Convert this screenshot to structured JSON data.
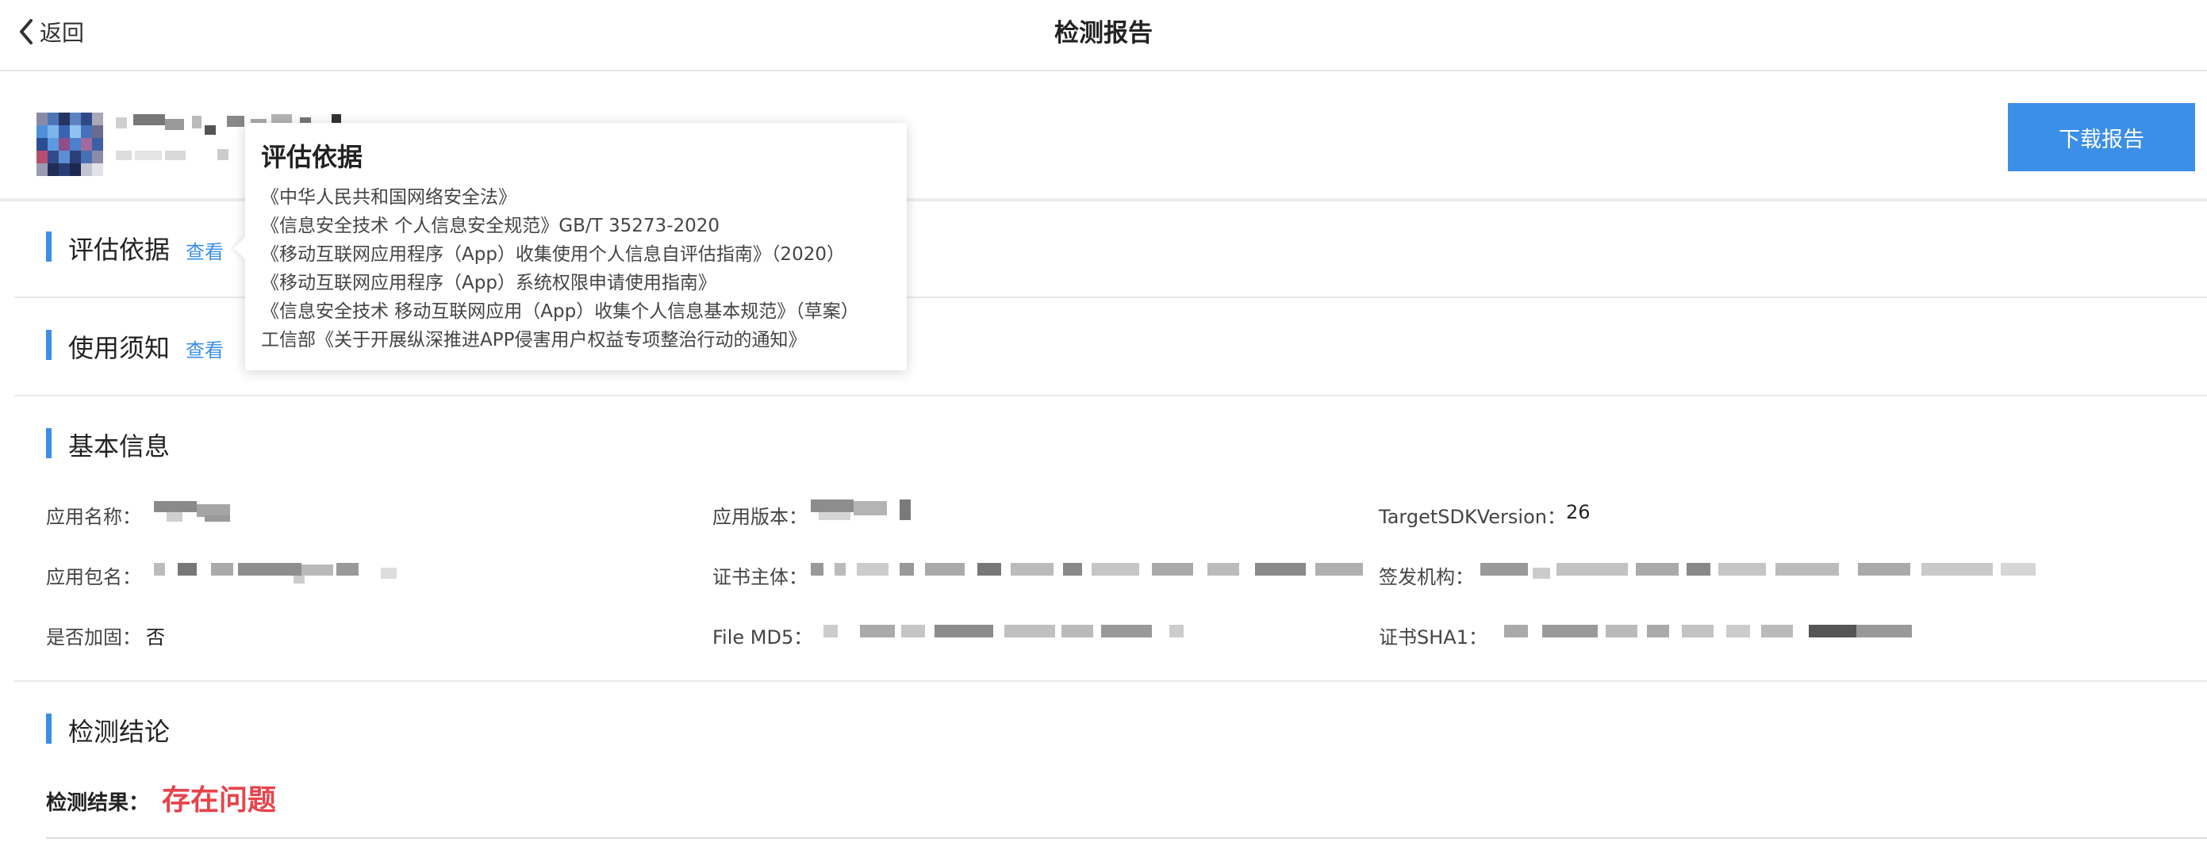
{
  "nav": {
    "back_label": "返回",
    "title": "检测报告"
  },
  "header": {
    "download_label": "下载报告"
  },
  "sections": {
    "basis": {
      "title": "评估依据",
      "link": "查看"
    },
    "notice": {
      "title": "使用须知",
      "link": "查看"
    },
    "basic": {
      "title": "基本信息"
    },
    "conclusion": {
      "title": "检测结论"
    }
  },
  "basic_info": {
    "app_name_label": "应用名称：",
    "app_version_label": "应用版本：",
    "target_sdk_label": "TargetSDKVersion：",
    "target_sdk_value": "26",
    "package_label": "应用包名：",
    "cert_subject_label": "证书主体：",
    "issuer_label": "签发机构：",
    "hardened_label": "是否加固：",
    "hardened_value": "否",
    "md5_label": "File MD5：",
    "sha1_label": "证书SHA1："
  },
  "result": {
    "label": "检测结果：",
    "value": "存在问题"
  },
  "tooltip": {
    "title": "评估依据",
    "items": [
      "《中华人民共和国网络安全法》",
      "《信息安全技术 个人信息安全规范》GB/T 35273-2020",
      "《移动互联网应用程序（App）收集使用个人信息自评估指南》（2020）",
      "《移动互联网应用程序（App）系统权限申请使用指南》",
      "《信息安全技术 移动互联网应用（App）收集个人信息基本规范》（草案）",
      "工信部《关于开展纵深推进APP侵害用户权益专项整治行动的通知》"
    ]
  },
  "colors": {
    "accent": "#3b8fe6",
    "danger": "#e8434b"
  },
  "icons": {
    "back": "chevron-left-icon"
  }
}
